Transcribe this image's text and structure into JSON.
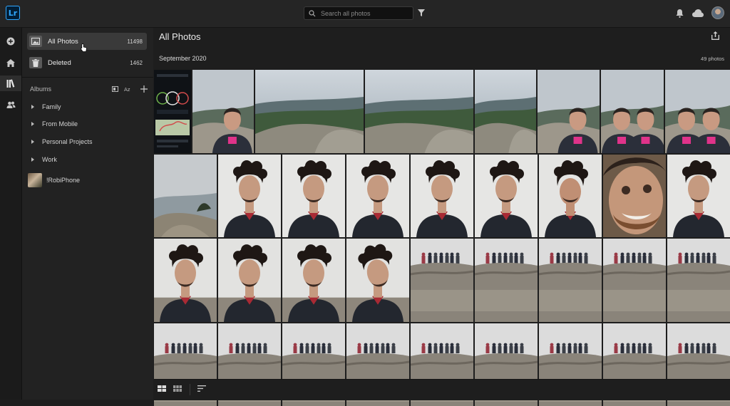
{
  "app": {
    "logo_text": "Lr",
    "search_placeholder": "Search all photos"
  },
  "topbar_icons": [
    "filter-icon",
    "bell-icon",
    "cloud-icon",
    "user-avatar"
  ],
  "rail": {
    "items": [
      "add-icon",
      "home-icon",
      "library-icon",
      "people-icon"
    ],
    "active": "library-icon"
  },
  "sidebar": {
    "nav": [
      {
        "label": "All Photos",
        "count": "11498",
        "icon": "photo-icon",
        "selected": true
      },
      {
        "label": "Deleted",
        "count": "1462",
        "icon": "trash-icon",
        "selected": false
      }
    ],
    "albums_label": "Albums",
    "albums": [
      {
        "label": "Family",
        "type": "folder"
      },
      {
        "label": "From Mobile",
        "type": "folder"
      },
      {
        "label": "Personal Projects",
        "type": "folder"
      },
      {
        "label": "Work",
        "type": "folder"
      },
      {
        "label": "!RobiPhone",
        "type": "album"
      }
    ]
  },
  "main": {
    "title": "All Photos",
    "group": {
      "date": "September 2020",
      "count": "49 photos"
    }
  },
  "photos": {
    "rows": [
      [
        {
          "kind": "app_screenshot"
        },
        {
          "kind": "selfie_man_mountain"
        },
        {
          "kind": "mountain_view"
        },
        {
          "kind": "mountain_view_wide"
        },
        {
          "kind": "mountain_rocks"
        },
        {
          "kind": "group_selfie_rocks"
        },
        {
          "kind": "group_selfie_two"
        },
        {
          "kind": "group_selfie_two_close"
        }
      ],
      [
        {
          "kind": "foggy_rocks"
        },
        {
          "kind": "curly_portrait"
        },
        {
          "kind": "curly_portrait"
        },
        {
          "kind": "curly_portrait"
        },
        {
          "kind": "curly_portrait"
        },
        {
          "kind": "curly_portrait"
        },
        {
          "kind": "curly_portrait_down"
        },
        {
          "kind": "closeup_face"
        },
        {
          "kind": "curly_portrait"
        }
      ],
      [
        {
          "kind": "curly_portrait_rock"
        },
        {
          "kind": "curly_portrait_rock"
        },
        {
          "kind": "curly_portrait_rock"
        },
        {
          "kind": "curly_portrait_side"
        },
        {
          "kind": "group_summit"
        },
        {
          "kind": "group_summit"
        },
        {
          "kind": "group_summit"
        },
        {
          "kind": "group_summit"
        },
        {
          "kind": "group_summit"
        }
      ],
      [
        {
          "kind": "group_summit_small"
        },
        {
          "kind": "group_summit_small"
        },
        {
          "kind": "group_summit_small"
        },
        {
          "kind": "group_summit_small"
        },
        {
          "kind": "group_summit_small"
        },
        {
          "kind": "group_summit_small"
        },
        {
          "kind": "group_summit_small"
        },
        {
          "kind": "group_summit_small"
        },
        {
          "kind": "group_summit_small"
        }
      ]
    ]
  },
  "bottombar_icons": [
    "grid-large-icon",
    "grid-small-icon",
    "sort-icon"
  ]
}
